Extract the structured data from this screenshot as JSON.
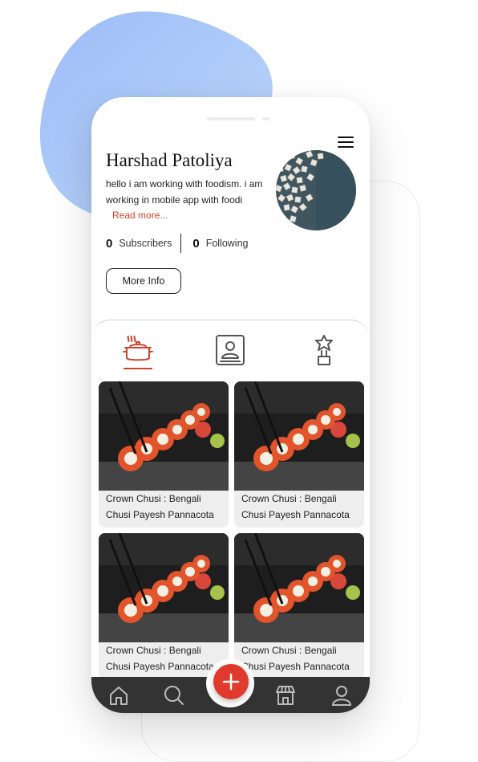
{
  "profile": {
    "name": "Harshad Patoliya",
    "bio": "hello i am working with foodism. i am working in mobile app with foodi",
    "read_more": "Read more...",
    "subscribers_count": "0",
    "subscribers_label": "Subscribers",
    "following_count": "0",
    "following_label": "Following",
    "more_info_label": "More Info"
  },
  "tabs": [
    {
      "icon": "cooking-pot-icon",
      "active": true
    },
    {
      "icon": "profile-card-icon",
      "active": false
    },
    {
      "icon": "award-trophy-icon",
      "active": false
    }
  ],
  "recipes": [
    {
      "title": "Crown Chusi : Bengali Chusi Payesh Pannacota"
    },
    {
      "title": "Crown Chusi : Bengali Chusi Payesh Pannacota"
    },
    {
      "title": "Crown Chusi : Bengali Chusi Payesh Pannacota"
    },
    {
      "title": "Crown Chusi : Bengali Chusi Payesh Pannacota"
    }
  ],
  "bottom_nav": [
    "home-icon",
    "search-icon",
    "add-icon",
    "store-icon",
    "user-icon"
  ],
  "colors": {
    "accent": "#d2432b",
    "fab": "#e03a2e",
    "nav_background": "#333333",
    "blob": "#a8c8f8"
  }
}
